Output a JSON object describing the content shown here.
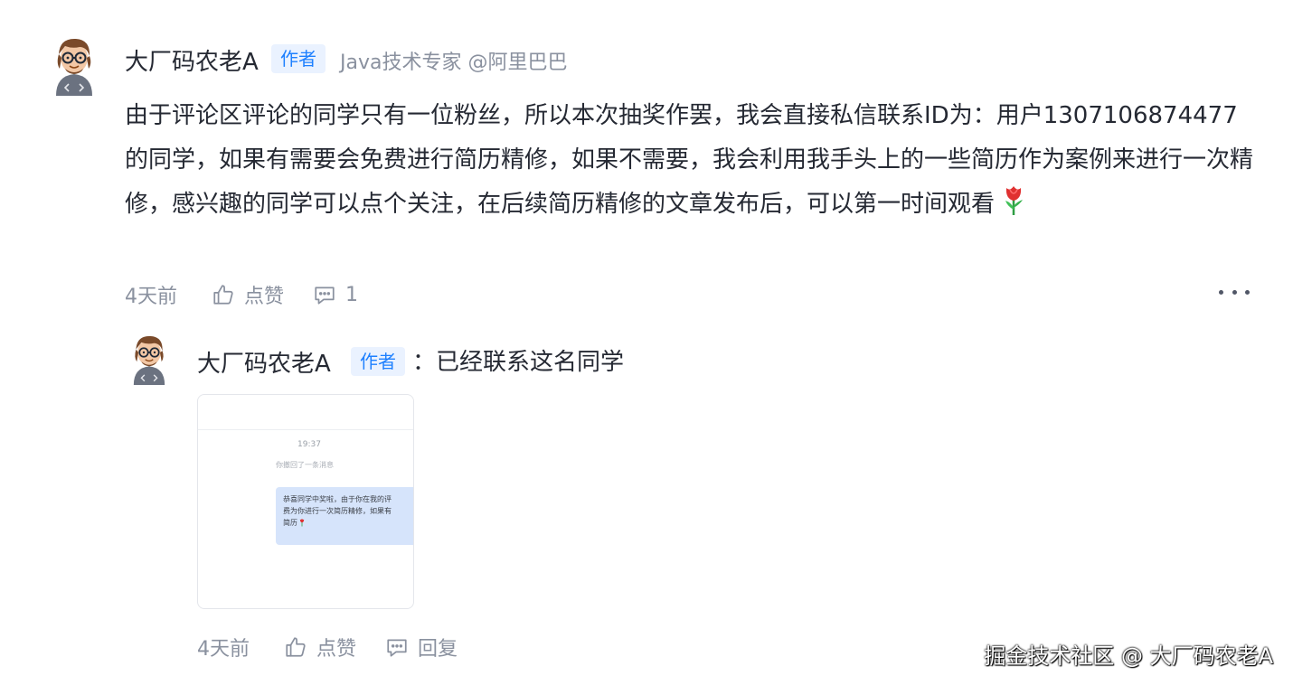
{
  "comment": {
    "author_name": "大厂码农老A",
    "author_tag": "作者",
    "author_job": "Java技术专家 @阿里巴巴",
    "text": "由于评论区评论的同学只有一位粉丝，所以本次抽奖作罢，我会直接私信联系ID为：用户1307106874477 的同学，如果有需要会免费进行简历精修，如果不需要，我会利用我手头上的一些简历作为案例来进行一次精修，感兴趣的同学可以点个关注，在后续简历精修的文章发布后，可以第一时间观看",
    "emoji_icon": "tulip-icon",
    "time": "4天前",
    "like_label": "点赞",
    "reply_count": "1",
    "more_icon": "more-dots-icon"
  },
  "reply": {
    "author_name": "大厂码农老A",
    "author_tag": "作者",
    "text": "：已经联系这名同学",
    "image": {
      "time": "19:37",
      "recall_note": "你撤回了一条消息",
      "bubble_lines": [
        "恭喜同学中奖啦，由于你在我的评",
        "费为你进行一次简历精修，如果有",
        "简历"
      ]
    },
    "time": "4天前",
    "like_label": "点赞",
    "reply_label": "回复"
  },
  "watermark": "掘金技术社区 @ 大厂码农老A",
  "colors": {
    "accent": "#1e80ff",
    "tag_bg": "#eaf2ff",
    "text_main": "#252933",
    "text_muted": "#8a919f"
  }
}
